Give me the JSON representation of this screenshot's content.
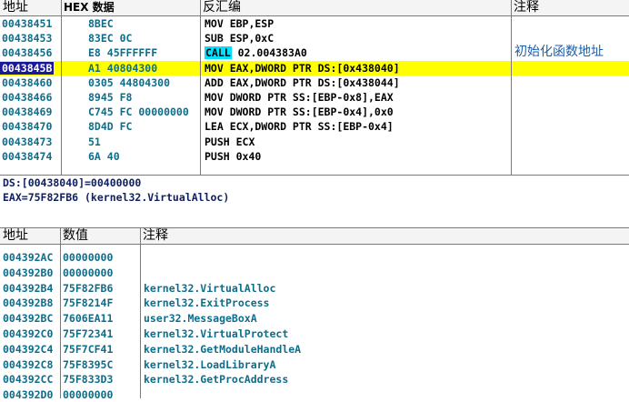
{
  "disasm": {
    "headers": {
      "address": "地址",
      "hex": "HEX 数据",
      "disasm": "反汇编",
      "comment": "注释"
    },
    "rows": [
      {
        "address": "00438451",
        "hex": "8BEC",
        "disasm": "MOV EBP,ESP",
        "comment": "",
        "selected": false
      },
      {
        "address": "00438453",
        "hex": "83EC 0C",
        "disasm": "SUB ESP,0xC",
        "comment": "",
        "selected": false
      },
      {
        "address": "00438456",
        "hex": "E8 45FFFFFF",
        "disasm_kw": "CALL",
        "disasm_rest": " 02.004383A0",
        "comment": "初始化函数地址",
        "selected": false
      },
      {
        "address": "0043845B",
        "hex": "A1 40804300",
        "disasm": "MOV EAX,DWORD PTR DS:[0x438040]",
        "comment": "",
        "selected": true
      },
      {
        "address": "00438460",
        "hex": "0305 44804300",
        "disasm": "ADD EAX,DWORD PTR DS:[0x438044]",
        "comment": "",
        "selected": false
      },
      {
        "address": "00438466",
        "hex": "8945 F8",
        "disasm": "MOV DWORD PTR SS:[EBP-0x8],EAX",
        "comment": "",
        "selected": false
      },
      {
        "address": "00438469",
        "hex": "C745 FC 00000000",
        "disasm": "MOV DWORD PTR SS:[EBP-0x4],0x0",
        "comment": "",
        "selected": false
      },
      {
        "address": "00438470",
        "hex": "8D4D FC",
        "disasm": "LEA ECX,DWORD PTR SS:[EBP-0x4]",
        "comment": "",
        "selected": false
      },
      {
        "address": "00438473",
        "hex": "51",
        "disasm": "PUSH ECX",
        "comment": "",
        "selected": false
      },
      {
        "address": "00438474",
        "hex": "6A 40",
        "disasm": "PUSH 0x40",
        "comment": "",
        "selected": false
      }
    ]
  },
  "info": {
    "line1": "DS:[00438040]=00400000",
    "line2": "EAX=75F82FB6 (kernel32.VirtualAlloc)"
  },
  "dump": {
    "headers": {
      "address": "地址",
      "value": "数值",
      "comment": "注释"
    },
    "rows": [
      {
        "address": "004392AC",
        "value": "00000000",
        "comment": ""
      },
      {
        "address": "004392B0",
        "value": "00000000",
        "comment": ""
      },
      {
        "address": "004392B4",
        "value": "75F82FB6",
        "comment": "kernel32.VirtualAlloc"
      },
      {
        "address": "004392B8",
        "value": "75F8214F",
        "comment": "kernel32.ExitProcess"
      },
      {
        "address": "004392BC",
        "value": "7606EA11",
        "comment": "user32.MessageBoxA"
      },
      {
        "address": "004392C0",
        "value": "75F72341",
        "comment": "kernel32.VirtualProtect"
      },
      {
        "address": "004392C4",
        "value": "75F7CF41",
        "comment": "kernel32.GetModuleHandleA"
      },
      {
        "address": "004392C8",
        "value": "75F8395C",
        "comment": "kernel32.LoadLibraryA"
      },
      {
        "address": "004392CC",
        "value": "75F833D3",
        "comment": "kernel32.GetProcAddress"
      },
      {
        "address": "004392D0",
        "value": "00000000",
        "comment": ""
      }
    ]
  },
  "colors": {
    "selection": "#ffff00",
    "selected_address": "#1a1a99",
    "call_highlight": "#00e0ff",
    "address_text": "#0e6d8a",
    "comment_text": "#1b5ea8"
  }
}
